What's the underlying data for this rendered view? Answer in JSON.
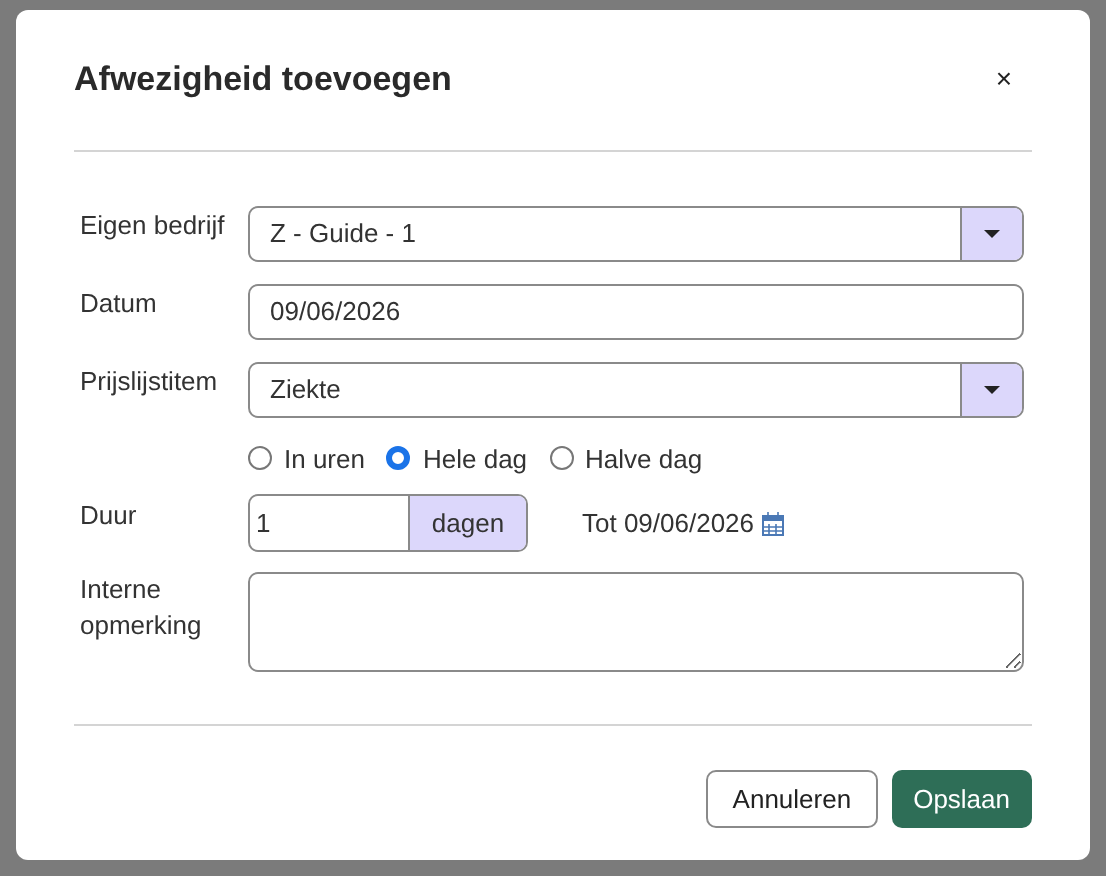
{
  "dialog": {
    "title": "Afwezigheid toevoegen",
    "close": "×"
  },
  "fields": [
    {
      "kind": "select",
      "label": "Eigen bedrijf",
      "value": "Z - Guide - 1"
    },
    {
      "kind": "text",
      "label": "Datum",
      "value": "09/06/2026"
    },
    {
      "kind": "select",
      "label": "Prijslijstitem",
      "value": "Ziekte"
    }
  ],
  "radios": [
    {
      "label": "In uren",
      "selected": false
    },
    {
      "label": "Hele dag",
      "selected": true
    },
    {
      "label": "Halve dag",
      "selected": false
    }
  ],
  "duration": {
    "label": "Duur",
    "value": "1",
    "unit": "dagen",
    "until": "Tot 09/06/2026"
  },
  "note": {
    "label": "Interne opmerking"
  },
  "buttons": [
    {
      "kind": "secondary",
      "label": "Annuleren"
    },
    {
      "kind": "primary",
      "label": "Opslaan"
    }
  ]
}
